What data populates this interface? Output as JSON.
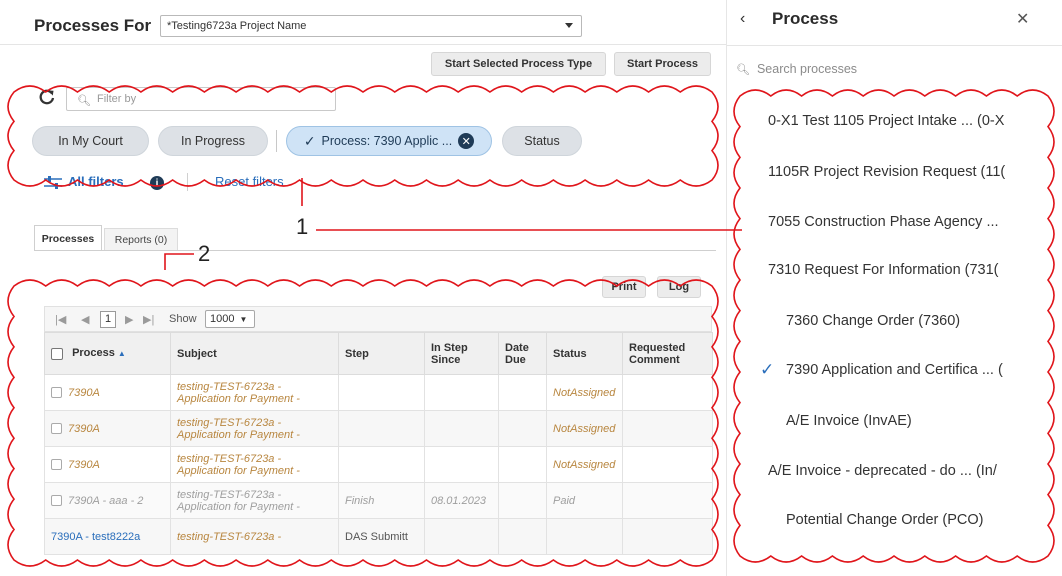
{
  "header": {
    "title": "Processes For",
    "project_select_value": "*Testing6723a Project Name",
    "start_selected_label": "Start Selected Process Type",
    "start_process_label": "Start Process"
  },
  "filters": {
    "filter_placeholder": "Filter by",
    "chips": [
      {
        "label": "In My Court"
      },
      {
        "label": "In Progress"
      },
      {
        "label": "Process: 7390 Applic ..."
      },
      {
        "label": "Status"
      }
    ],
    "all_filters_label": "All filters",
    "reset_filters_label": "Reset filters"
  },
  "tabs": [
    {
      "label": "Processes"
    },
    {
      "label": "Reports (0)"
    }
  ],
  "grid_toolbar": {
    "print_label": "Print",
    "log_label": "Log"
  },
  "pager": {
    "page": "1",
    "show_label": "Show",
    "page_size": "1000"
  },
  "table": {
    "columns": [
      "Process",
      "Subject",
      "Step",
      "In Step Since",
      "Date Due",
      "Status",
      "Requested Comment"
    ],
    "rows": [
      {
        "process": "7390A",
        "subject": "testing-TEST-6723a - Application for Payment -",
        "step": "",
        "in_step_since": "",
        "date_due": "",
        "status": "NotAssigned",
        "comment": ""
      },
      {
        "process": "7390A",
        "subject": "testing-TEST-6723a - Application for Payment -",
        "step": "",
        "in_step_since": "",
        "date_due": "",
        "status": "NotAssigned",
        "comment": ""
      },
      {
        "process": "7390A",
        "subject": "testing-TEST-6723a - Application for Payment -",
        "step": "",
        "in_step_since": "",
        "date_due": "",
        "status": "NotAssigned",
        "comment": ""
      },
      {
        "process": "7390A - aaa - 2",
        "subject": "testing-TEST-6723a - Application for Payment -",
        "step": "Finish",
        "in_step_since": "08.01.2023",
        "date_due": "",
        "status": "Paid",
        "comment": ""
      },
      {
        "process": "7390A - test8222a",
        "subject": "testing-TEST-6723a -",
        "step": "DAS Submitt",
        "in_step_since": "",
        "date_due": "",
        "status": "",
        "comment": ""
      }
    ]
  },
  "panel": {
    "title": "Process",
    "search_placeholder": "Search processes",
    "items": [
      {
        "label": "0-X1 Test 1105 Project Intake ... (0-X"
      },
      {
        "label": "1105R Project Revision Request (11("
      },
      {
        "label": "7055 Construction Phase Agency ..."
      },
      {
        "label": "7310 Request For Information (731("
      },
      {
        "label": "7360 Change Order (7360)"
      },
      {
        "label": "7390 Application and Certifica ... ("
      },
      {
        "label": "A/E Invoice (InvAE)"
      },
      {
        "label": "A/E Invoice - deprecated - do ... (In/"
      },
      {
        "label": "Potential Change Order (PCO)"
      }
    ]
  },
  "annotations": {
    "callout_1": "1",
    "callout_2": "2",
    "cloud_color": "#e0151b"
  }
}
